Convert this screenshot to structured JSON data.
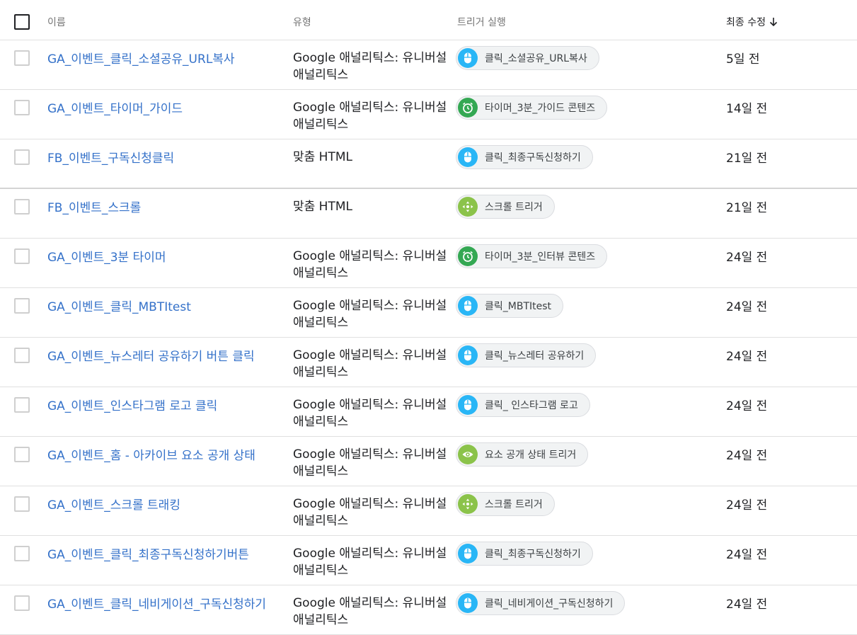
{
  "header": {
    "name": "이름",
    "type": "유형",
    "triggers": "트리거 실행",
    "modified": "최종 수정"
  },
  "trigger_colors": {
    "click": "#29b6f6",
    "timer": "#34a853",
    "scroll": "#8bc34a",
    "visibility": "#8bc34a"
  },
  "rows": [
    {
      "name": "GA_이벤트_클릭_소셜공유_URL복사",
      "type": "Google 애널리틱스: 유니버설 애널리틱스",
      "trigger": "클릭_소셜공유_URL복사",
      "trigger_icon": "mouse-icon",
      "trigger_kind": "click",
      "modified": "5일 전"
    },
    {
      "name": "GA_이벤트_타이머_가이드",
      "type": "Google 애널리틱스: 유니버설 애널리틱스",
      "trigger": "타이머_3분_가이드 콘텐즈",
      "trigger_icon": "timer-icon",
      "trigger_kind": "timer",
      "modified": "14일 전"
    },
    {
      "name": "FB_이벤트_구독신청클릭",
      "type": "맞춤 HTML",
      "trigger": "클릭_최종구독신청하기",
      "trigger_icon": "mouse-icon",
      "trigger_kind": "click",
      "modified": "21일 전"
    },
    {
      "name": "FB_이벤트_스크롤",
      "type": "맞춤 HTML",
      "trigger": "스크롤 트리거",
      "trigger_icon": "scroll-icon",
      "trigger_kind": "scroll",
      "modified": "21일 전"
    },
    {
      "name": "GA_이벤트_3분 타이머",
      "type": "Google 애널리틱스: 유니버설 애널리틱스",
      "trigger": "타이머_3분_인터뷰 콘텐즈",
      "trigger_icon": "timer-icon",
      "trigger_kind": "timer",
      "modified": "24일 전"
    },
    {
      "name": "GA_이벤트_클릭_MBTItest",
      "type": "Google 애널리틱스: 유니버설 애널리틱스",
      "trigger": "클릭_MBTItest",
      "trigger_icon": "mouse-icon",
      "trigger_kind": "click",
      "modified": "24일 전"
    },
    {
      "name": "GA_이벤트_뉴스레터 공유하기 버튼 클릭",
      "type": "Google 애널리틱스: 유니버설 애널리틱스",
      "trigger": "클릭_뉴스레터 공유하기",
      "trigger_icon": "mouse-icon",
      "trigger_kind": "click",
      "modified": "24일 전"
    },
    {
      "name": "GA_이벤트_인스타그램 로고 클릭",
      "type": "Google 애널리틱스: 유니버설 애널리틱스",
      "trigger": "클릭_ 인스타그램 로고",
      "trigger_icon": "mouse-icon",
      "trigger_kind": "click",
      "modified": "24일 전"
    },
    {
      "name": "GA_이벤트_홈 - 아카이브 요소 공개 상태",
      "type": "Google 애널리틱스: 유니버설 애널리틱스",
      "trigger": "요소 공개 상태 트리거",
      "trigger_icon": "eye-icon",
      "trigger_kind": "visibility",
      "modified": "24일 전"
    },
    {
      "name": "GA_이벤트_스크롤 트래킹",
      "type": "Google 애널리틱스: 유니버설 애널리틱스",
      "trigger": "스크롤 트리거",
      "trigger_icon": "scroll-icon",
      "trigger_kind": "scroll",
      "modified": "24일 전"
    },
    {
      "name": "GA_이벤트_클릭_최종구독신청하기버튼",
      "type": "Google 애널리틱스: 유니버설 애널리틱스",
      "trigger": "클릭_최종구독신청하기",
      "trigger_icon": "mouse-icon",
      "trigger_kind": "click",
      "modified": "24일 전"
    },
    {
      "name": "GA_이벤트_클릭_네비게이션_구독신청하기",
      "type": "Google 애널리틱스: 유니버설 애널리틱스",
      "trigger": "클릭_네비게이션_구독신청하기",
      "trigger_icon": "mouse-icon",
      "trigger_kind": "click",
      "modified": "24일 전"
    }
  ]
}
